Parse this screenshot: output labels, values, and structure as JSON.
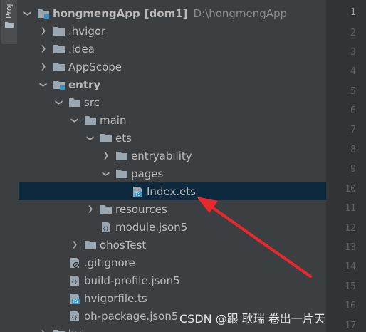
{
  "tool_window_tab": {
    "label": "Proj"
  },
  "tree": {
    "root": {
      "name": "hongmengApp",
      "module": "[dom1]",
      "path": "D:\\hongmengApp"
    },
    "items": [
      {
        "label": "hongmengApp",
        "type": "module-folder",
        "expanded": true
      },
      {
        "label": ".hvigor",
        "type": "folder"
      },
      {
        "label": ".idea",
        "type": "folder"
      },
      {
        "label": "AppScope",
        "type": "folder"
      },
      {
        "label": "entry",
        "type": "module-folder",
        "expanded": true
      },
      {
        "label": "src",
        "type": "folder",
        "expanded": true
      },
      {
        "label": "main",
        "type": "folder",
        "expanded": true
      },
      {
        "label": "ets",
        "type": "folder",
        "expanded": true
      },
      {
        "label": "entryability",
        "type": "folder"
      },
      {
        "label": "pages",
        "type": "folder",
        "expanded": true
      },
      {
        "label": "Index.ets",
        "type": "ts-file",
        "selected": true
      },
      {
        "label": "resources",
        "type": "folder"
      },
      {
        "label": "module.json5",
        "type": "json-file"
      },
      {
        "label": "ohosTest",
        "type": "folder"
      },
      {
        "label": ".gitignore",
        "type": "ignore-file"
      },
      {
        "label": "build-profile.json5",
        "type": "json-file"
      },
      {
        "label": "hvigorfile.ts",
        "type": "ts-file"
      },
      {
        "label": "oh-package.json5",
        "type": "json-file"
      },
      {
        "label": "hvi",
        "type": "folder"
      }
    ]
  },
  "line_numbers": [
    "1",
    "2",
    "3",
    "4",
    "5",
    "6",
    "7",
    "8",
    "9",
    "10",
    "11",
    "12",
    "13",
    "14",
    "15",
    "16",
    "17"
  ],
  "watermark": "CSDN @跟 耿瑞 卷出一片天",
  "colors": {
    "selection": "#0d293e",
    "arrow": "#e8282c",
    "folder": "#9aa7b0",
    "module_badge": "#3592c4"
  }
}
